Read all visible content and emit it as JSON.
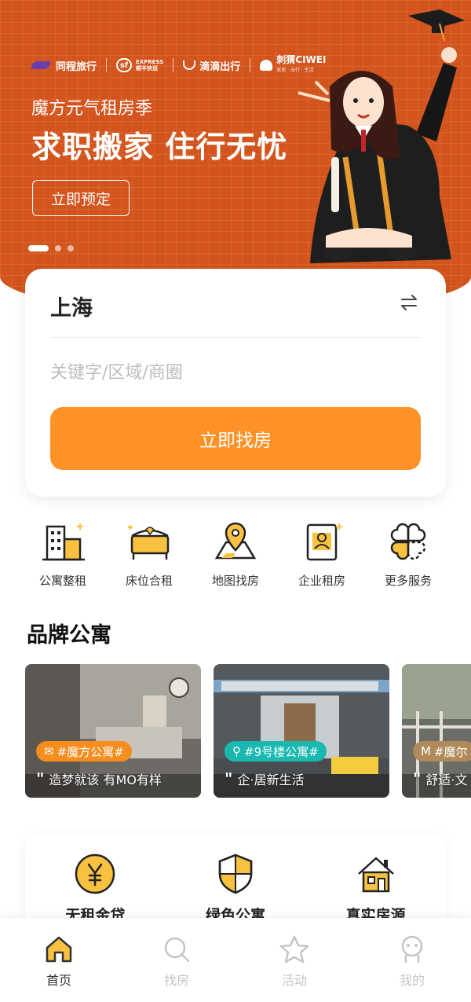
{
  "banner": {
    "partners": {
      "tongcheng": "同程旅行",
      "sf_express": "EXPRESS",
      "sf_name": "顺丰快运",
      "sf_logo_text": "sf",
      "didi": "滴滴出行",
      "ciwei": "刺猬CIWEI",
      "ciwei_sub": "家居 · 出行 · 生活"
    },
    "subtitle": "魔方元气租房季",
    "title": "求职搬家 住行无忧",
    "book_button": "立即预定",
    "carousel": {
      "total": 3,
      "active_index": 0
    }
  },
  "search": {
    "city": "上海",
    "keyword_value": "",
    "keyword_placeholder": "关键字/区域/商圈",
    "find_button": "立即找房"
  },
  "quick_menu": [
    {
      "label": "公寓整租",
      "icon": "apartment-building-icon"
    },
    {
      "label": "床位合租",
      "icon": "bed-icon"
    },
    {
      "label": "地图找房",
      "icon": "map-pin-icon"
    },
    {
      "label": "企业租房",
      "icon": "enterprise-id-icon"
    },
    {
      "label": "更多服务",
      "icon": "clover-more-icon"
    }
  ],
  "brand_section": {
    "title": "品牌公寓",
    "cards": [
      {
        "tag": "#魔方公寓#",
        "tag_color": "#f58d1f",
        "slogan": "造梦就该 有MO有样",
        "icon": "envelope-icon"
      },
      {
        "tag": "#9号楼公寓#",
        "tag_color": "#19b9b0",
        "slogan": "企·居新生活",
        "icon": "location-pin-icon"
      },
      {
        "tag": "#魔尔",
        "tag_color": "#b08a5a",
        "slogan": "舒适·文",
        "icon": "m-logo-icon"
      }
    ]
  },
  "features": [
    {
      "label": "无租金贷",
      "icon": "yen-coin-icon"
    },
    {
      "label": "绿色公寓",
      "icon": "shield-icon"
    },
    {
      "label": "真实房源",
      "icon": "house-icon"
    }
  ],
  "bottom_nav": [
    {
      "label": "首页",
      "icon": "home-icon",
      "active": true
    },
    {
      "label": "找房",
      "icon": "search-icon",
      "active": false
    },
    {
      "label": "活动",
      "icon": "star-icon",
      "active": false
    },
    {
      "label": "我的",
      "icon": "profile-icon",
      "active": false
    }
  ],
  "colors": {
    "banner_orange": "#d3541c",
    "accent_orange": "#fe9227",
    "icon_yellow": "#f9c140",
    "nav_inactive": "#c5c5c5"
  }
}
